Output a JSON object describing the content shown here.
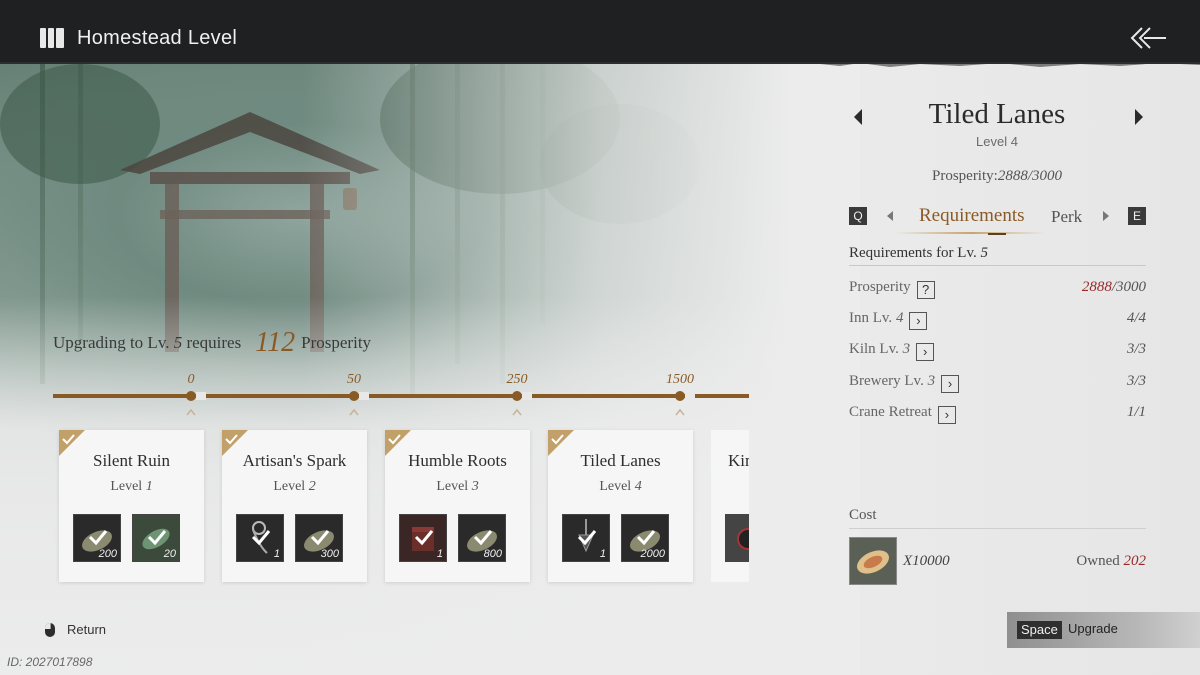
{
  "header": {
    "title": "Homestead Level",
    "logo_icon": "book-icon",
    "back_icon": "back-arrow-icon"
  },
  "upgrade_message": {
    "prefix": "Upgrading to Lv. ",
    "level": "5",
    "middle": " requires",
    "amount": "112",
    "unit": "Prosperity"
  },
  "track": {
    "ticks": [
      "0",
      "50",
      "250",
      "1500"
    ],
    "accent": "#8a5a25"
  },
  "cards": [
    {
      "name": "Silent Ruin",
      "level_prefix": "Level ",
      "level": "1",
      "completed": true,
      "items": [
        {
          "icon": "fruit-icon",
          "qty": "200"
        },
        {
          "icon": "leaf-icon",
          "qty": "20"
        }
      ]
    },
    {
      "name": "Artisan's Spark",
      "level_prefix": "Level ",
      "level": "2",
      "completed": true,
      "items": [
        {
          "icon": "cord-icon",
          "qty": "1"
        },
        {
          "icon": "fruit-icon",
          "qty": "300"
        }
      ]
    },
    {
      "name": "Humble Roots",
      "level_prefix": "Level ",
      "level": "3",
      "completed": true,
      "items": [
        {
          "icon": "box-icon",
          "qty": "1"
        },
        {
          "icon": "fruit-icon",
          "qty": "800"
        }
      ]
    },
    {
      "name": "Tiled Lanes",
      "level_prefix": "Level ",
      "level": "4",
      "completed": true,
      "items": [
        {
          "icon": "pendant-icon",
          "qty": "1"
        },
        {
          "icon": "fruit-icon",
          "qty": "2000"
        }
      ]
    },
    {
      "name": "Kin",
      "partial": true
    }
  ],
  "panel": {
    "building_name": "Tiled Lanes",
    "building_level": "Level 4",
    "prosperity_label": "Prosperity:",
    "prosperity_value": "2888/3000",
    "tabs": {
      "left_key": "Q",
      "right_key": "E",
      "active": "Requirements",
      "next": "Perk"
    },
    "requirements_title_prefix": "Requirements for Lv. ",
    "requirements_title_level": "5",
    "requirements": [
      {
        "label": "Prosperity",
        "level": "",
        "button": "?",
        "value_current": "2888",
        "value_total": "/3000",
        "highlight": true
      },
      {
        "label": "Inn Lv. ",
        "level": "4",
        "button": "›",
        "value_current": "4",
        "value_total": "/4",
        "highlight": false
      },
      {
        "label": "Kiln Lv. ",
        "level": "3",
        "button": "›",
        "value_current": "3",
        "value_total": "/3",
        "highlight": false
      },
      {
        "label": "Brewery Lv. ",
        "level": "3",
        "button": "›",
        "value_current": "3",
        "value_total": "/3",
        "highlight": false
      },
      {
        "label": "Crane Retreat",
        "level": "",
        "button": "›",
        "value_current": "1",
        "value_total": "/1",
        "highlight": false
      }
    ],
    "cost_title": "Cost",
    "cost_item": {
      "icon": "melon-slice-icon",
      "qty": "X10000"
    },
    "owned_label": "Owned ",
    "owned_value": "202"
  },
  "footer": {
    "upgrade_key": "Space",
    "upgrade_label": "Upgrade",
    "return_label": "Return",
    "return_icon": "mouse-icon",
    "uid": "ID: 2027017898"
  },
  "colors": {
    "accent": "#8a5a25",
    "warn": "#9a2a2a",
    "header_bg": "#1e2022"
  }
}
